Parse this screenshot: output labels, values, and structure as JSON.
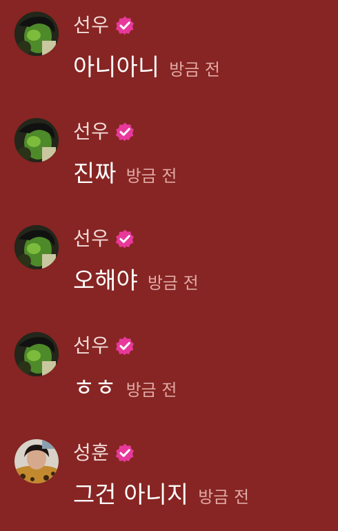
{
  "colors": {
    "background": "#862523",
    "name_text": "#f2dcda",
    "message_text": "#ffffff",
    "timestamp_text": "#e2a9a6",
    "verified_badge": "#e8399b"
  },
  "messages": [
    {
      "sender": "선우",
      "text": "아니아니",
      "time": "방금 전",
      "verified": true,
      "avatar": "avatar-sunwoo"
    },
    {
      "sender": "선우",
      "text": "진짜",
      "time": "방금 전",
      "verified": true,
      "avatar": "avatar-sunwoo"
    },
    {
      "sender": "선우",
      "text": "오해야",
      "time": "방금 전",
      "verified": true,
      "avatar": "avatar-sunwoo"
    },
    {
      "sender": "선우",
      "text": "ㅎㅎ",
      "time": "방금 전",
      "verified": true,
      "avatar": "avatar-sunwoo"
    },
    {
      "sender": "성훈",
      "text": "그건 아니지",
      "time": "방금 전",
      "verified": true,
      "avatar": "avatar-sunghoon"
    }
  ]
}
